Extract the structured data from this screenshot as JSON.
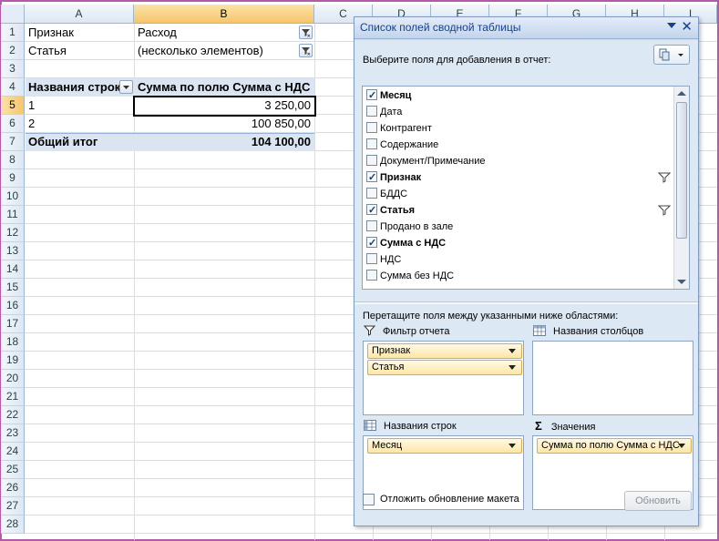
{
  "sheet": {
    "columns": [
      "A",
      "B",
      "C",
      "D",
      "E",
      "F",
      "G",
      "H",
      "I"
    ],
    "rows": [
      "1",
      "2",
      "3",
      "4",
      "5",
      "6",
      "7",
      "8",
      "9",
      "10",
      "11",
      "12",
      "13",
      "14",
      "15",
      "16",
      "17",
      "18",
      "19",
      "20",
      "21",
      "22",
      "23",
      "24",
      "25",
      "26",
      "27",
      "28"
    ],
    "cells": {
      "a1": "Признак",
      "b1": "Расход",
      "a2": "Статья",
      "b2": "(несколько элементов)",
      "a4": "Названия строк",
      "b4": "Сумма по полю Сумма с НДС",
      "a5": "1",
      "b5": "3 250,00",
      "a6": "2",
      "b6": "100 850,00",
      "a7": "Общий итог",
      "b7": "104 100,00"
    }
  },
  "pane": {
    "title": "Список полей сводной таблицы",
    "choose_label": "Выберите поля для добавления в отчет:",
    "fields": [
      {
        "label": "Месяц",
        "checked": true,
        "filtered": false
      },
      {
        "label": "Дата",
        "checked": false,
        "filtered": false
      },
      {
        "label": "Контрагент",
        "checked": false,
        "filtered": false
      },
      {
        "label": "Содержание",
        "checked": false,
        "filtered": false
      },
      {
        "label": "Документ/Примечание",
        "checked": false,
        "filtered": false
      },
      {
        "label": "Признак",
        "checked": true,
        "filtered": true
      },
      {
        "label": "БДДС",
        "checked": false,
        "filtered": false
      },
      {
        "label": "Статья",
        "checked": true,
        "filtered": true
      },
      {
        "label": "Продано в зале",
        "checked": false,
        "filtered": false
      },
      {
        "label": "Сумма с НДС",
        "checked": true,
        "filtered": false
      },
      {
        "label": "НДС",
        "checked": false,
        "filtered": false
      },
      {
        "label": "Сумма без НДС",
        "checked": false,
        "filtered": false
      }
    ],
    "drag_label": "Перетащите поля между указанными ниже областями:",
    "areas": {
      "filter_title": "Фильтр отчета",
      "columns_title": "Названия столбцов",
      "rows_title": "Названия строк",
      "values_title": "Значения",
      "filter_items": [
        "Признак",
        "Статья"
      ],
      "row_items": [
        "Месяц"
      ],
      "value_items": [
        "Сумма по полю Сумма с НДС"
      ]
    },
    "defer_label": "Отложить обновление макета",
    "update_label": "Обновить"
  }
}
